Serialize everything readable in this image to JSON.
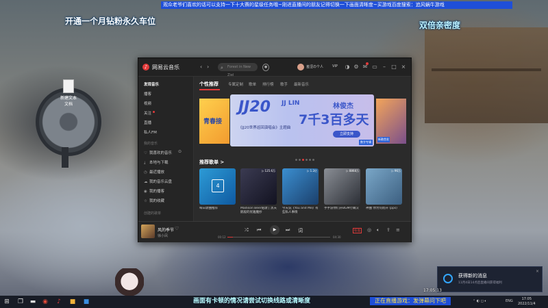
{
  "overlay": {
    "marquee": "观众老爷们喜欢的话可以支持一下十大赛的星级任务哦~刚进直播间的朋友记得切换一下画面清晰度~买游戏百度搜索：追风蜗牛游戏",
    "left_text": "开通一个月钻粉永久车位",
    "right_text": "双倍亲密度",
    "caption": "画面有卡顿的情况请尝试切换线路或清晰度",
    "live_banner": "正在直播游戏：发弹幕问下吧"
  },
  "desktop": {
    "file_label": "新建文本文档"
  },
  "app": {
    "name": "网易云音乐",
    "search_placeholder": "Forest in New Ziel",
    "user": "羞涩の个人",
    "vip": "VIP"
  },
  "sidebar": {
    "items": [
      {
        "label": "发现音乐"
      },
      {
        "label": "播客"
      },
      {
        "label": "视频"
      },
      {
        "label": "关注"
      },
      {
        "label": "直播"
      },
      {
        "label": "私人FM"
      }
    ],
    "section_label": "我的音乐",
    "my_items": [
      {
        "label": "我喜欢的音乐"
      },
      {
        "label": "本地与下载"
      },
      {
        "label": "最近播放"
      },
      {
        "label": "我的音乐云盘"
      },
      {
        "label": "我的播客"
      },
      {
        "label": "我的收藏"
      }
    ],
    "created_label": "创建的歌单"
  },
  "tabs": [
    "个性推荐",
    "专属定制",
    "歌单",
    "排行榜",
    "歌手",
    "最新音乐"
  ],
  "banner": {
    "title": "JJ20",
    "artist_en": "JJ LIN",
    "artist_cn": "林俊杰",
    "headline": "7千3百多天",
    "subtitle": "《JJ20世界巡回演唱会》主题曲",
    "button": "立即支持",
    "tag": "数字专辑",
    "left_text": "青春接",
    "right_tag": "新歌首发"
  },
  "recommend": {
    "title": "推荐歌单 >",
    "calendar_day": "4",
    "cards": [
      {
        "caption": "每日歌曲推荐",
        "plays": ""
      },
      {
        "caption": "Madison Beer贴歌 | 黑天鹅般的优雅魔抄",
        "plays": "▷ 125.6万"
      },
      {
        "caption": "今天说《You and Me》有些私人事情",
        "plays": "▷ 1.2亿"
      },
      {
        "caption": "手手游你们开BGM行确汉",
        "plays": "▷ 8868万"
      },
      {
        "caption": "神曲 你为何而开 (pps)",
        "plays": "▷ 96万"
      }
    ]
  },
  "player": {
    "title": "风的季节",
    "artist": "徐小凤",
    "time_current": "00:12",
    "time_total": "04:30",
    "quality": "标准",
    "progress": 0.05
  },
  "notification": {
    "title": "获得新的消息",
    "body": "11月4日14点后直播间获得福利",
    "clock": "17:05:13"
  },
  "taskbar": {
    "lang": "ENG",
    "time": "17:05",
    "date": "2022/11/4"
  }
}
